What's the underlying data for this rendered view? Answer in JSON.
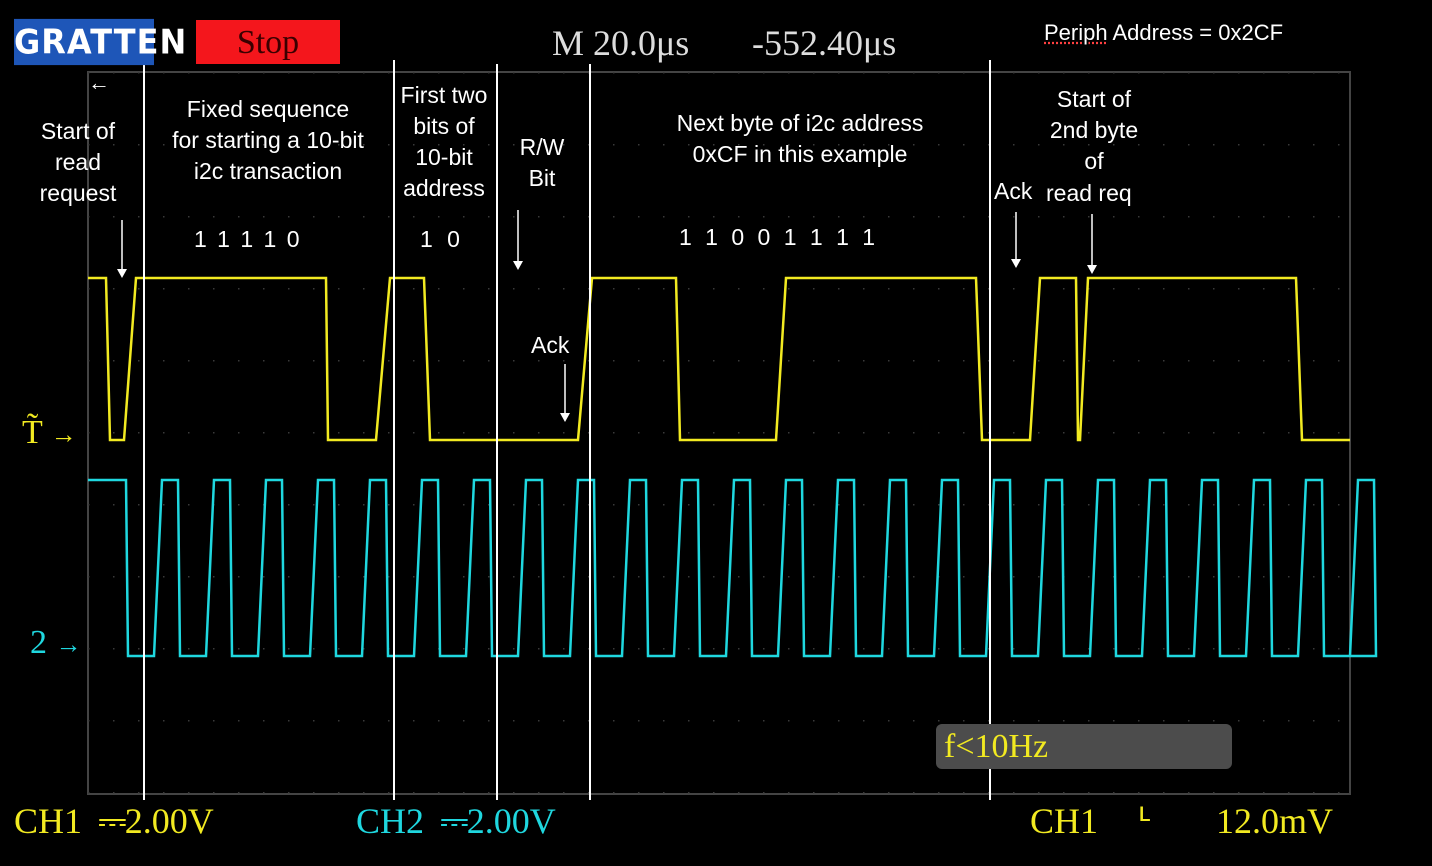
{
  "header": {
    "brand": "GRATTEN",
    "stop_label": "Stop",
    "timebase": "M 20.0μs",
    "trigger_offset": "-552.40μs",
    "periph_word": "Periph",
    "periph_rest": " Address = 0x2CF"
  },
  "markers": {
    "ch1": "T̃",
    "ch2": "2"
  },
  "annotations": {
    "start_read": [
      "Start of",
      "read",
      "request"
    ],
    "fixed_seq": [
      "Fixed sequence",
      "for starting a 10-bit",
      "i2c transaction"
    ],
    "first_two": [
      "First two",
      "bits of",
      "10-bit",
      "address"
    ],
    "rw_bit": [
      "R/W",
      "Bit"
    ],
    "next_byte": [
      "Next byte of i2c address",
      "0xCF in this example"
    ],
    "start_second": [
      "Start of",
      "2nd byte",
      "of"
    ],
    "read_req": "read req",
    "ack_mid": "Ack",
    "ack_right": "Ack"
  },
  "bits": {
    "fixed": "1 1 1 1 0",
    "first_two": "1 0",
    "next_byte": "1 1 0 0 1 1 1 1"
  },
  "footer": {
    "ch1_label": "CH1",
    "ch1_scale": "2.00V",
    "ch2_label": "CH2",
    "ch2_scale": "2.00V",
    "trig_label": "CH1",
    "trig_symbol": "⫯",
    "trig_level": "12.0mV",
    "freq": "f<10Hz"
  },
  "colors": {
    "ch1": "#f2ea21",
    "ch2": "#1fd7df",
    "stop": "#f4161c",
    "brand": "#1e56b8"
  }
}
